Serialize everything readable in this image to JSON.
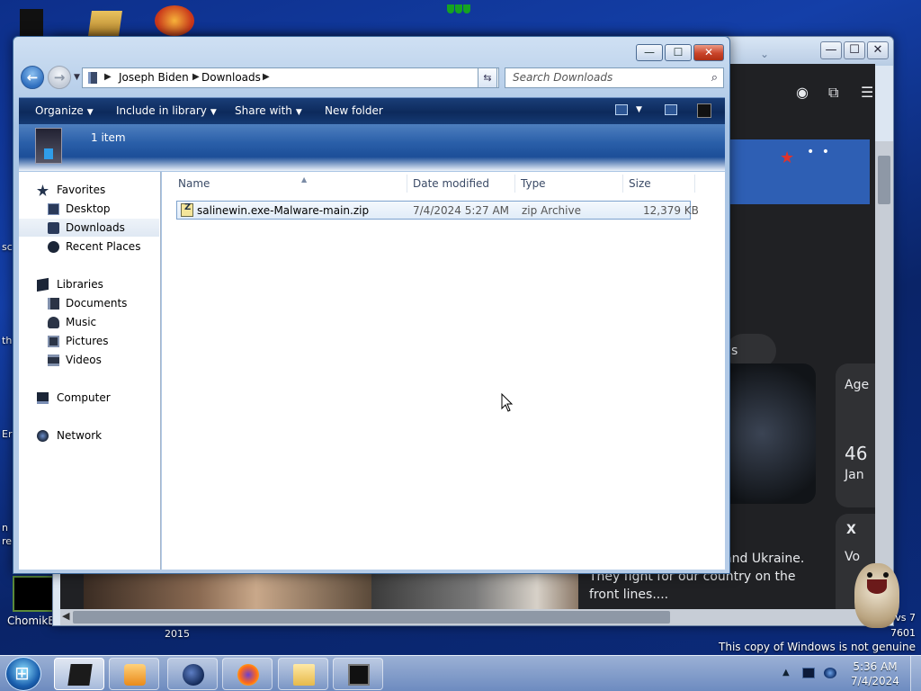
{
  "desktop": {
    "side_texts": [
      "sc",
      "th",
      "Er",
      "n",
      "re"
    ],
    "chomik_label": "ChomikB",
    "year_label": "2015",
    "genuine_notice": "This copy of Windows is not genuine",
    "win_version": "vs 7",
    "build": "7601"
  },
  "browser": {
    "pill_text": "s",
    "card_age": "Age",
    "card_num": "46",
    "card_month": "Jan",
    "card_x": "X",
    "card_vo": "Vo",
    "story_text": "icers who defend life and Ukraine. They fight for our country on the front lines...."
  },
  "explorer": {
    "address": {
      "crumbs": [
        "Joseph Biden",
        "Downloads"
      ],
      "search_placeholder": "Search Downloads"
    },
    "commands": {
      "organize": "Organize",
      "include_in_library": "Include in library",
      "share_with": "Share with",
      "new_folder": "New folder"
    },
    "details": {
      "item_count": "1 item"
    },
    "nav": {
      "favorites": "Favorites",
      "desktop": "Desktop",
      "downloads": "Downloads",
      "recent_places": "Recent Places",
      "libraries": "Libraries",
      "documents": "Documents",
      "music": "Music",
      "pictures": "Pictures",
      "videos": "Videos",
      "computer": "Computer",
      "network": "Network"
    },
    "columns": {
      "name": "Name",
      "date_modified": "Date modified",
      "type": "Type",
      "size": "Size"
    },
    "files": [
      {
        "name": "salinewin.exe-Malware-main.zip",
        "date_modified": "7/4/2024 5:27 AM",
        "type": "zip Archive",
        "size": "12,379 KB"
      }
    ]
  },
  "taskbar": {
    "time": "5:36 AM",
    "date": "7/4/2024"
  }
}
